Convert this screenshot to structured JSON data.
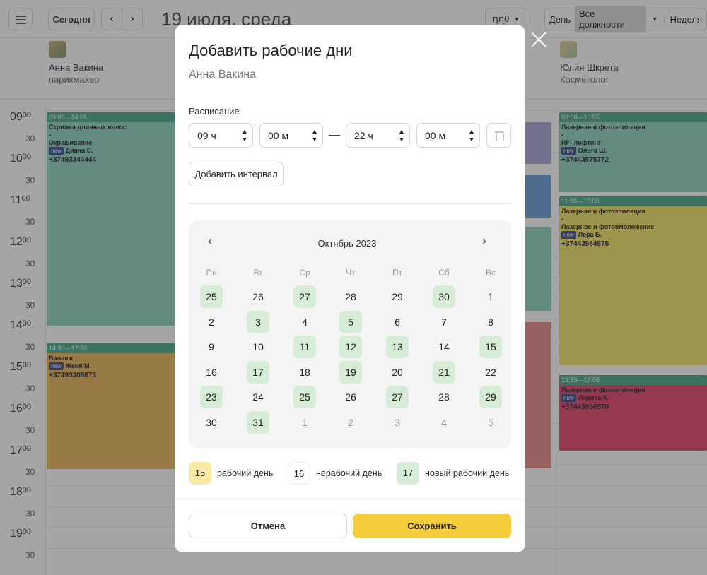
{
  "topbar": {
    "today_label": "Сегодня",
    "prev_icon": "‹",
    "next_icon": "›",
    "date_title": "19 июля, среда",
    "lang_label": "ղղ0",
    "view_day": "День",
    "view_position": "Все должности",
    "view_week": "Неделя"
  },
  "staff": [
    {
      "name": "Анна Вакина",
      "role": "парикмахер"
    },
    {
      "name": "Юлия Шкрета",
      "role": "Косметолог"
    }
  ],
  "time_labels": [
    {
      "hour": "09",
      "min": "00"
    },
    {
      "half": "30"
    },
    {
      "hour": "10",
      "min": "00"
    },
    {
      "half": "30"
    },
    {
      "hour": "11",
      "min": "00"
    },
    {
      "half": "30"
    },
    {
      "hour": "12",
      "min": "00"
    },
    {
      "half": "30"
    },
    {
      "hour": "13",
      "min": "00"
    },
    {
      "half": "30"
    },
    {
      "hour": "14",
      "min": "00"
    },
    {
      "half": "30"
    },
    {
      "hour": "15",
      "min": "00"
    },
    {
      "half": "30"
    },
    {
      "hour": "16",
      "min": "00"
    },
    {
      "half": "30"
    },
    {
      "hour": "17",
      "min": "00"
    },
    {
      "half": "30"
    },
    {
      "hour": "18",
      "min": "00"
    },
    {
      "half": "30"
    },
    {
      "hour": "19",
      "min": "00"
    },
    {
      "half": "30"
    }
  ],
  "events": [
    {
      "time": "09:00—14:05",
      "lines": [
        "Стрижка длинных волос",
        "-",
        "Окрашивание"
      ],
      "badge": "new",
      "client": "Диана С.",
      "phone": "+37493344444",
      "head_color": "#4aa88a",
      "body_color": "#8fd3bd"
    },
    {
      "time": "14:30—17:30",
      "lines": [
        "Балаяж"
      ],
      "badge": "new",
      "client": "Женя М.",
      "phone": "+37493309873",
      "head_color": "#4aa88a",
      "body_color": "#e6b35a"
    },
    {
      "time": "09:00—10:55",
      "lines": [
        "Лазерная и фотоэпиляция",
        "-",
        "RF- лифтинг"
      ],
      "badge": "new",
      "client": "Ольга Ш.",
      "phone": "+37443575772",
      "head_color": "#4aa88a",
      "body_color": "#8fd3bd"
    },
    {
      "time": "11:00—15:00",
      "lines": [
        "Лазерная и фотоэпиляция",
        "-",
        "Лазерное и фотоомоложение"
      ],
      "badge": "new",
      "client": "Лера Б.",
      "phone": "+37443984875",
      "head_color": "#4aa88a",
      "body_color": "#f1e36a"
    },
    {
      "time": "15:15—17:05",
      "lines": [
        "Лазерная и фотоэпиляция"
      ],
      "badge": "new",
      "client": "Лариса К.",
      "phone": "+37443656570",
      "head_color": "#4aa88a",
      "body_color": "#e2456a"
    }
  ],
  "modal": {
    "title": "Добавить рабочие дни",
    "employee": "Анна Вакина",
    "schedule_label": "Расписание",
    "from_hour": "09 ч",
    "from_min": "00 м",
    "to_hour": "22 ч",
    "to_min": "00 м",
    "add_interval": "Добавить интервал",
    "calendar": {
      "month": "Октябрь 2023",
      "weekdays": [
        "Пн",
        "Вт",
        "Ср",
        "Чт",
        "Пт",
        "Сб",
        "Вс"
      ],
      "weeks": [
        [
          {
            "d": "25",
            "s": "green"
          },
          {
            "d": "26",
            "s": ""
          },
          {
            "d": "27",
            "s": "green"
          },
          {
            "d": "28",
            "s": ""
          },
          {
            "d": "29",
            "s": ""
          },
          {
            "d": "30",
            "s": "green"
          },
          {
            "d": "1",
            "s": ""
          }
        ],
        [
          {
            "d": "2",
            "s": ""
          },
          {
            "d": "3",
            "s": "green"
          },
          {
            "d": "4",
            "s": ""
          },
          {
            "d": "5",
            "s": "green"
          },
          {
            "d": "6",
            "s": ""
          },
          {
            "d": "7",
            "s": ""
          },
          {
            "d": "8",
            "s": ""
          }
        ],
        [
          {
            "d": "9",
            "s": ""
          },
          {
            "d": "10",
            "s": ""
          },
          {
            "d": "11",
            "s": "green"
          },
          {
            "d": "12",
            "s": "green"
          },
          {
            "d": "13",
            "s": "green"
          },
          {
            "d": "14",
            "s": ""
          },
          {
            "d": "15",
            "s": "green"
          }
        ],
        [
          {
            "d": "16",
            "s": ""
          },
          {
            "d": "17",
            "s": "green"
          },
          {
            "d": "18",
            "s": ""
          },
          {
            "d": "19",
            "s": "green"
          },
          {
            "d": "20",
            "s": ""
          },
          {
            "d": "21",
            "s": "green"
          },
          {
            "d": "22",
            "s": ""
          }
        ],
        [
          {
            "d": "23",
            "s": "green"
          },
          {
            "d": "24",
            "s": ""
          },
          {
            "d": "25",
            "s": "green"
          },
          {
            "d": "26",
            "s": ""
          },
          {
            "d": "27",
            "s": "green"
          },
          {
            "d": "28",
            "s": ""
          },
          {
            "d": "29",
            "s": "green"
          }
        ],
        [
          {
            "d": "30",
            "s": ""
          },
          {
            "d": "31",
            "s": "green"
          },
          {
            "d": "1",
            "s": "other"
          },
          {
            "d": "2",
            "s": "other"
          },
          {
            "d": "3",
            "s": "other"
          },
          {
            "d": "4",
            "s": "other"
          },
          {
            "d": "5",
            "s": "other"
          }
        ]
      ]
    },
    "legend": [
      {
        "num": "15",
        "label": "рабочий день",
        "color": "#fbe9a6"
      },
      {
        "num": "16",
        "label": "нерабочий день",
        "color": "#ffffff"
      },
      {
        "num": "17",
        "label": "новый рабочий день",
        "color": "#d7ecd6"
      }
    ],
    "cancel": "Отмена",
    "save": "Сохранить"
  }
}
